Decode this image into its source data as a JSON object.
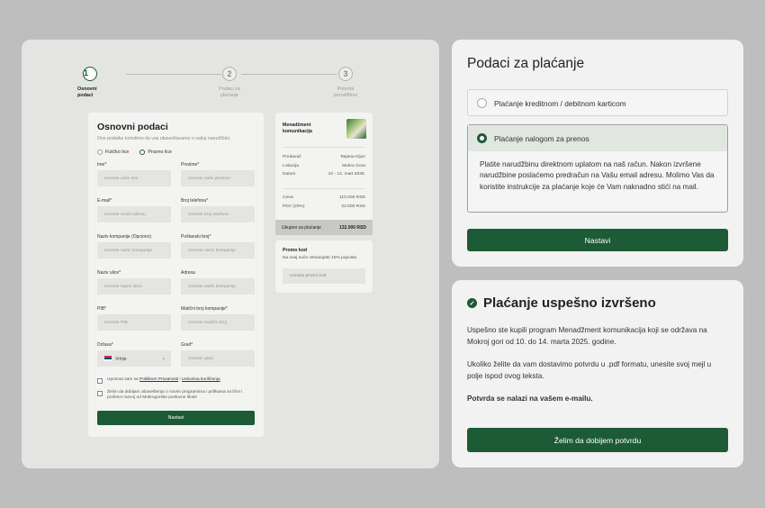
{
  "stepper": {
    "steps": [
      {
        "num": "1",
        "label": "Osnovni podaci"
      },
      {
        "num": "2",
        "label": "Podaci za plaćanje"
      },
      {
        "num": "3",
        "label": "Potvrda porudžbine"
      }
    ]
  },
  "form": {
    "title": "Osnovni podaci",
    "subtitle": "Ove podatke koristimo da vas obaveštavamo o vašoj narudžbini.",
    "type_individual": "Fizičko lice",
    "type_company": "Pravno lice",
    "fields": {
      "ime": {
        "label": "Ime*",
        "placeholder": "Unesite vaše ime"
      },
      "prezime": {
        "label": "Prezime*",
        "placeholder": "Unesite vaše prezime"
      },
      "email": {
        "label": "E-mail*",
        "placeholder": "Unesite email adresu"
      },
      "telefon": {
        "label": "Broj telefona*",
        "placeholder": "Unesite broj telefona"
      },
      "kompanija": {
        "label": "Naziv kompanije (Opciono)",
        "placeholder": "Unesite naziv kompanije"
      },
      "postanski": {
        "label": "Poštanski broj*",
        "placeholder": "Unesite naziv kompanije"
      },
      "ulica": {
        "label": "Naziv ulice*",
        "placeholder": "Unesite Naziv ulice"
      },
      "adresa": {
        "label": "Adresa",
        "placeholder": "Unesite vaših kompanija"
      },
      "pib": {
        "label": "PIB*",
        "placeholder": "Unesite PIB"
      },
      "maticni": {
        "label": "Matični broj kompanije*",
        "placeholder": "Unesite matični broj"
      },
      "drzava": {
        "label": "Država*",
        "value": "Srbija"
      },
      "grad": {
        "label": "Grad*",
        "placeholder": "Unesite grad"
      }
    },
    "consent_prefix": "Upoznat sam sa",
    "privacy_link": "Politikom Privatnosti",
    "consent_sep": "i",
    "terms_link": "Uslovima korišćenja",
    "newsletter": "Želim da dobijam obaveštenja o novim programima i prilikama za lični i profesni razvoj od Mokrogorske poslovne škole",
    "submit_label": "Nastavi"
  },
  "summary": {
    "title": "Menadžment komunikacija",
    "rows": [
      {
        "label": "Predavač",
        "value": "Tatjana Kljun"
      },
      {
        "label": "Lokacija",
        "value": "Mokra Gora"
      },
      {
        "label": "Datum",
        "value": "10 - 14. mart 2025."
      }
    ],
    "price_rows": [
      {
        "label": "Cena",
        "value": "110.000 RSD"
      },
      {
        "label": "PDV (20%)",
        "value": "22.000 RSD"
      }
    ],
    "total_label": "Ukupno za plaćanje",
    "total_value": "132.000 RSD"
  },
  "promo": {
    "title": "Promo kod",
    "subtitle": "Na ovaj nuče ostvarujete 10% popusta",
    "placeholder": "Unesite promo kod"
  },
  "payment": {
    "title": "Podaci za plaćanje",
    "option_card": "Plaćanje kreditnom / debitnom karticom",
    "option_transfer": "Plaćanje nalogom za prenos",
    "transfer_text": "Platite narudžbinu direktnom uplatom na naš račun. Nakon izvršene narudžbine poslaćemo predračun na Vašu email adresu. Molimo Vas da koristite instrukcije za plaćanje koje će Vam naknadno stići na mail.",
    "continue_label": "Nastavi"
  },
  "success": {
    "title": "Plaćanje uspešno izvršeno",
    "para1": "Uspešno ste kupili program Menadžment komunikacija  koji se održava na Mokroj gori od 10. do 14. marta 2025. godine.",
    "para2": "Ukoliko želite da vam dostavimo potvrdu u .pdf formatu, unesite svoj mejl u polje ispod ovog teksta.",
    "para3": "Potvrda se nalazi na vašem e-mailu.",
    "button_label": "Želim da dobijem potvrdu"
  },
  "colors": {
    "accent": "#1d5a36",
    "panel": "#f2f2f2",
    "background": "#bebebe"
  }
}
